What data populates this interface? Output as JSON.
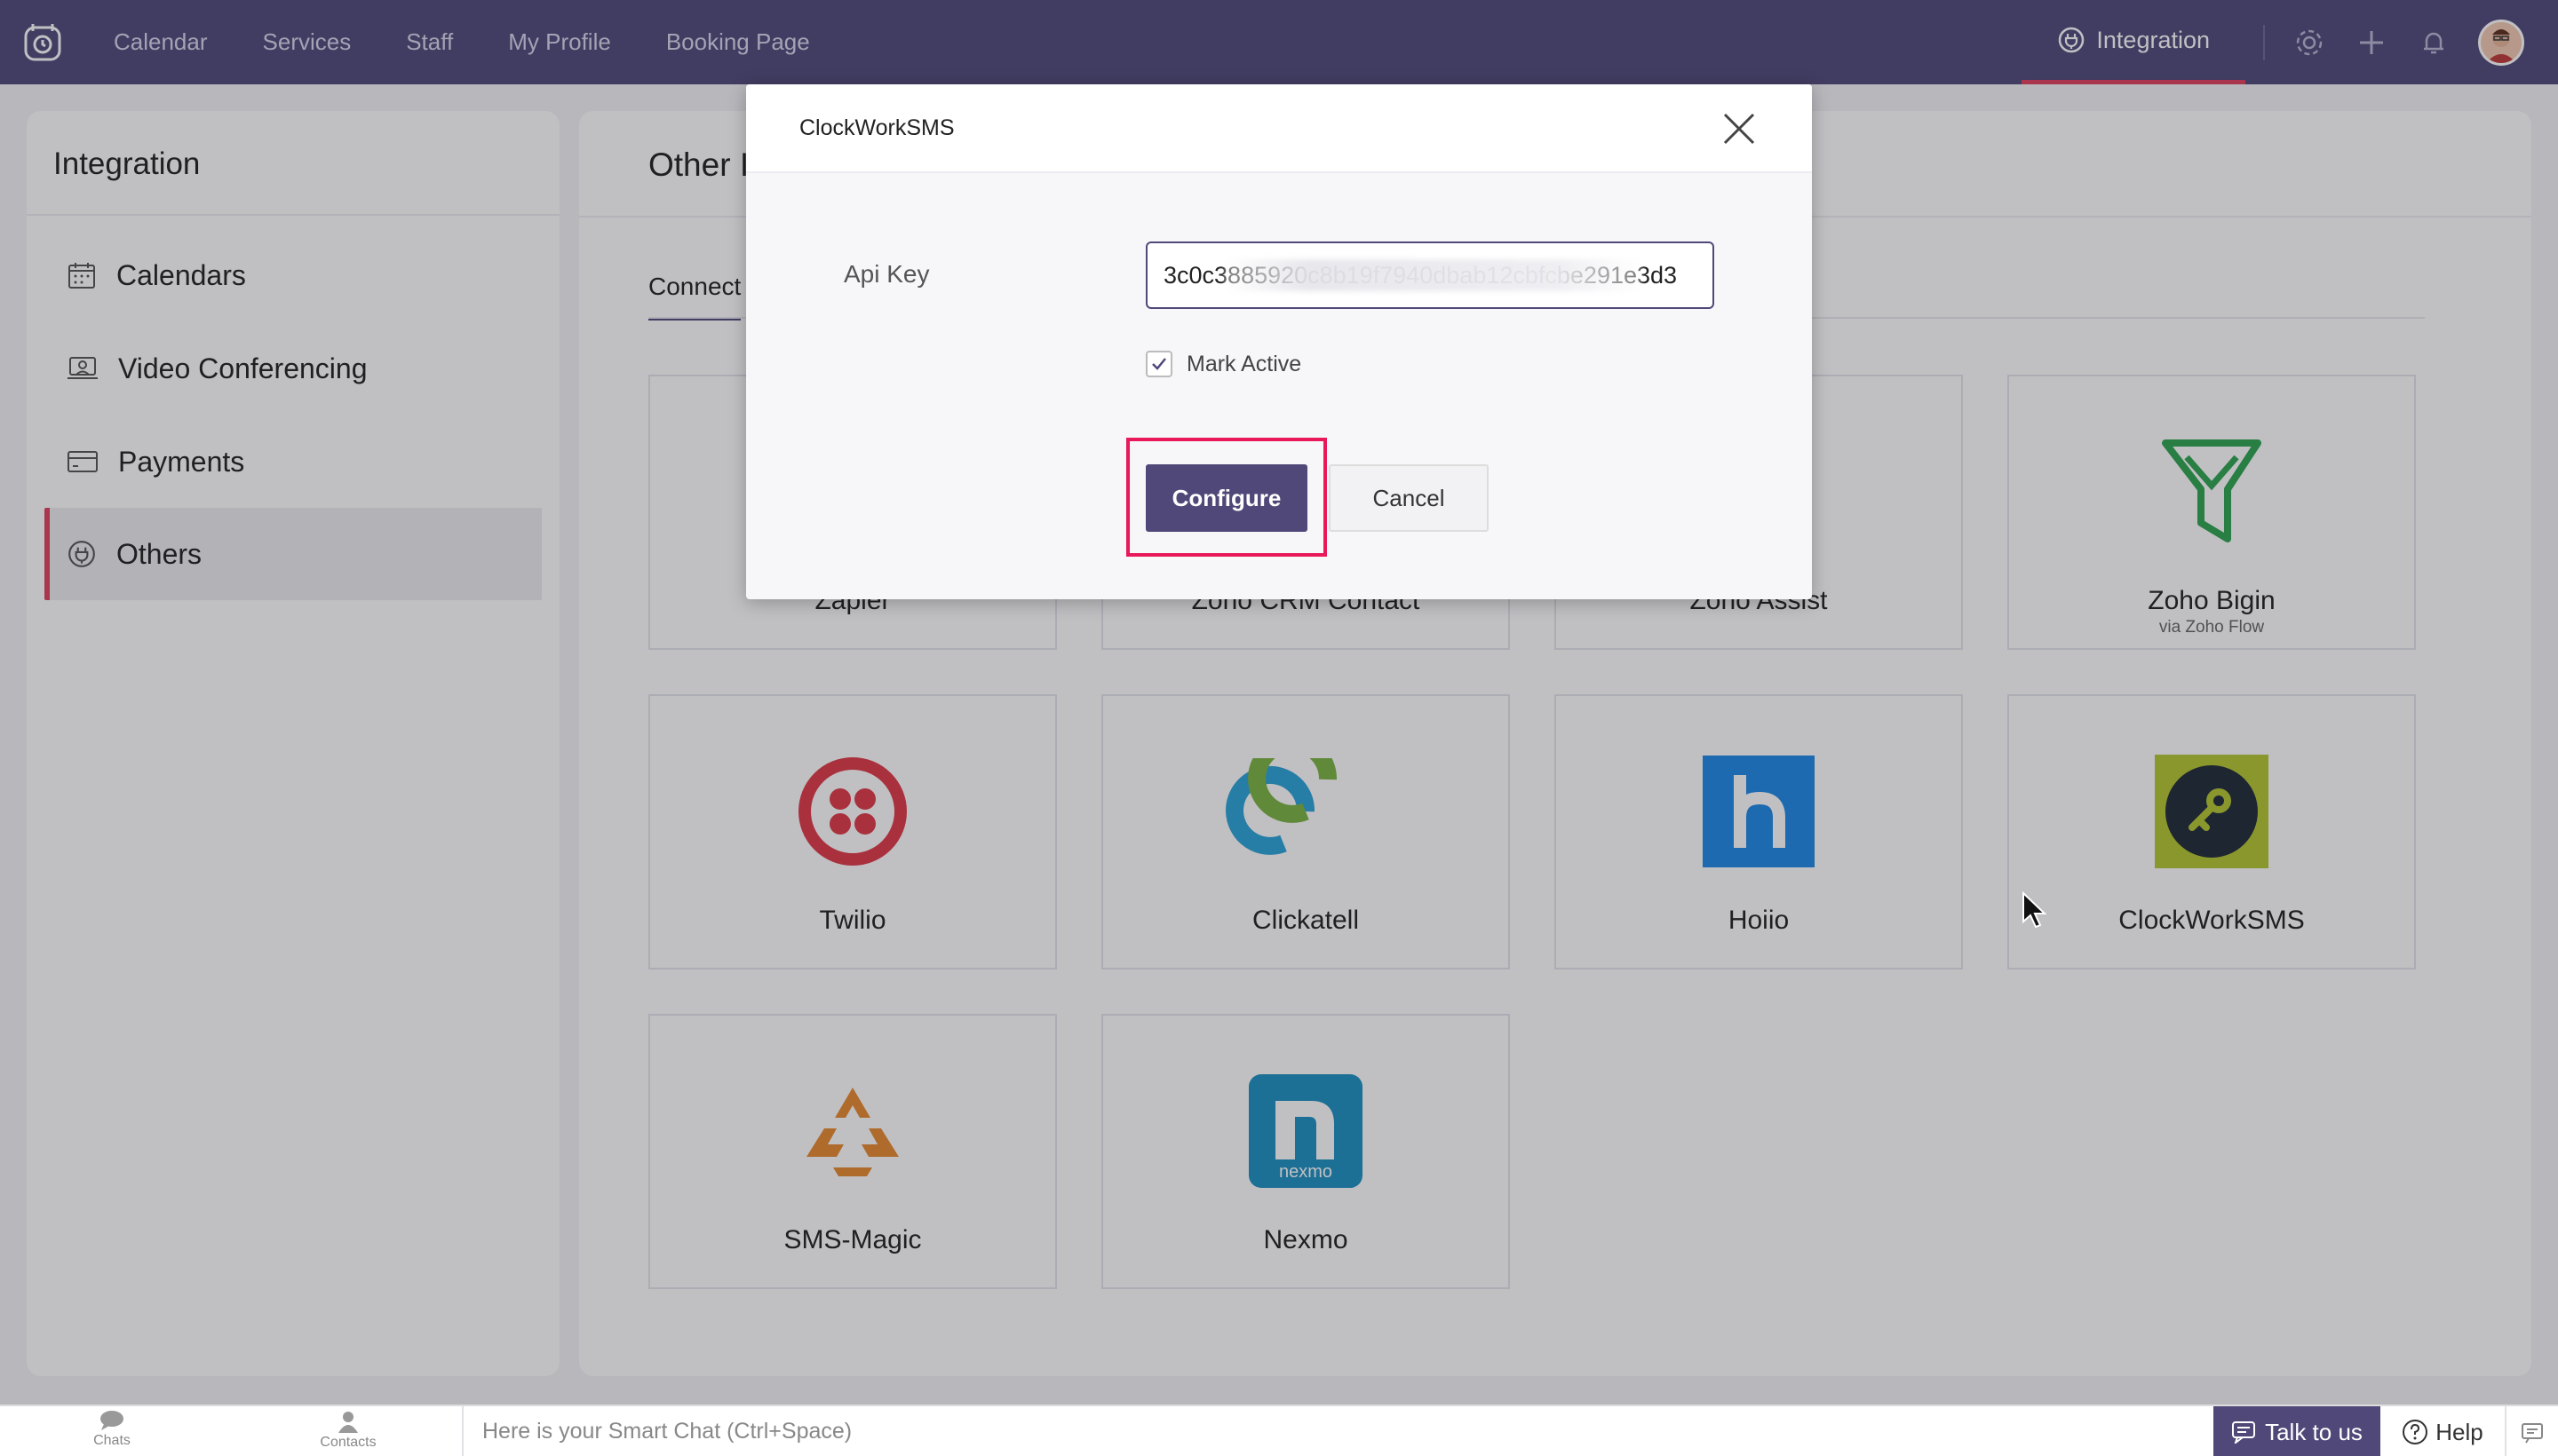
{
  "topbar": {
    "nav": [
      "Calendar",
      "Services",
      "Staff",
      "My Profile",
      "Booking Page"
    ],
    "integration_tab": "Integration"
  },
  "sidebar": {
    "title": "Integration",
    "items": [
      {
        "label": "Calendars",
        "icon": "calendar-icon"
      },
      {
        "label": "Video Conferencing",
        "icon": "video-icon"
      },
      {
        "label": "Payments",
        "icon": "card-icon"
      },
      {
        "label": "Others",
        "icon": "plug-icon",
        "active": true
      }
    ]
  },
  "main": {
    "title_partial": "Other I",
    "tab_partial": "Connect",
    "cards_row1": [
      {
        "name": "Zapier"
      },
      {
        "name": "Zoho CRM Contact"
      },
      {
        "name": "Zoho Assist"
      },
      {
        "name": "Zoho Bigin",
        "sub": "via Zoho Flow"
      }
    ],
    "cards": [
      {
        "name": "Twilio"
      },
      {
        "name": "Clickatell"
      },
      {
        "name": "Hoiio"
      },
      {
        "name": "ClockWorkSMS"
      },
      {
        "name": "SMS-Magic"
      },
      {
        "name": "Nexmo"
      }
    ]
  },
  "modal": {
    "title": "ClockWorkSMS",
    "api_label": "Api Key",
    "api_value": "3c0c3885920c8b19f7940dbab12cbfcbe291e3d3",
    "mark_active_label": "Mark Active",
    "mark_active_checked": true,
    "configure_label": "Configure",
    "cancel_label": "Cancel"
  },
  "bottombar": {
    "chats": "Chats",
    "contacts": "Contacts",
    "smart_chat_placeholder": "Here is your Smart Chat (Ctrl+Space)",
    "talk": "Talk to us",
    "help": "Help"
  },
  "colors": {
    "brand": "#504878",
    "accent": "#e0415a",
    "highlight": "#e8185a"
  }
}
